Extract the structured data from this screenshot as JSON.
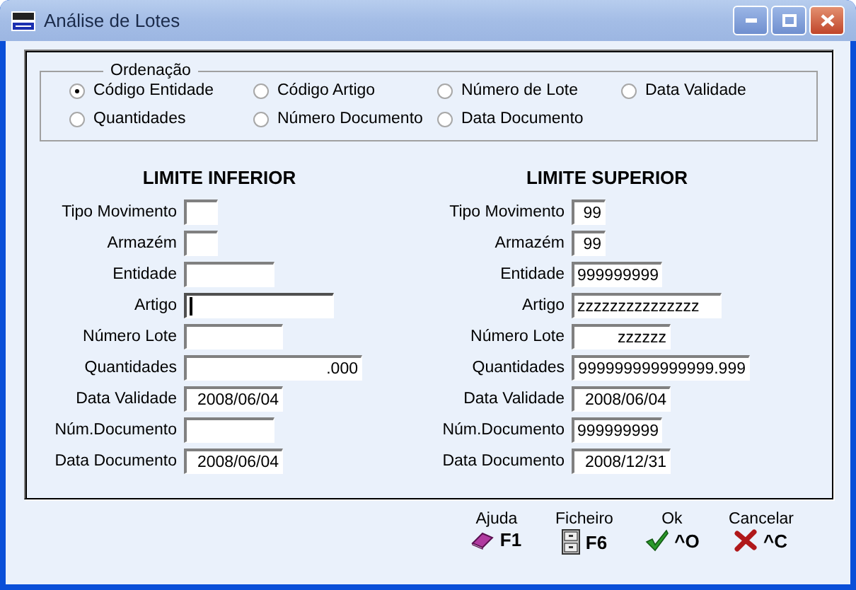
{
  "window": {
    "title": "Análise de Lotes"
  },
  "ordering": {
    "title": "Ordenação",
    "options": [
      {
        "label": "Código Entidade",
        "selected": true
      },
      {
        "label": "Código Artigo",
        "selected": false
      },
      {
        "label": "Número de Lote",
        "selected": false
      },
      {
        "label": "Data Validade",
        "selected": false
      },
      {
        "label": "Quantidades",
        "selected": false
      },
      {
        "label": "Número Documento",
        "selected": false
      },
      {
        "label": "Data Documento",
        "selected": false
      }
    ]
  },
  "limits": [
    {
      "title": "LIMITE INFERIOR",
      "fields": [
        {
          "label": "Tipo Movimento",
          "focused": false
        },
        {
          "label": "Armazém",
          "focused": false
        },
        {
          "label": "Entidade",
          "focused": false
        },
        {
          "label": "Artigo",
          "focused": true
        },
        {
          "label": "Número Lote",
          "focused": false
        },
        {
          "label": "Quantidades",
          "value": ".000",
          "focused": false
        },
        {
          "label": "Data Validade",
          "value": "2008/06/04",
          "focused": false
        },
        {
          "label": "Núm.Documento",
          "focused": false
        },
        {
          "label": "Data Documento",
          "value": "2008/06/04",
          "focused": false
        }
      ]
    },
    {
      "title": "LIMITE SUPERIOR",
      "fields": [
        {
          "label": "Tipo Movimento",
          "value": "99",
          "focused": false
        },
        {
          "label": "Armazém",
          "value": "99",
          "focused": false
        },
        {
          "label": "Entidade",
          "value": "999999999",
          "focused": false
        },
        {
          "label": "Artigo",
          "value": "zzzzzzzzzzzzzzz",
          "focused": false
        },
        {
          "label": "Número Lote",
          "value": "zzzzzz",
          "focused": false
        },
        {
          "label": "Quantidades",
          "value": "999999999999999.999",
          "focused": false
        },
        {
          "label": "Data Validade",
          "value": "2008/06/04",
          "focused": false
        },
        {
          "label": "Núm.Documento",
          "value": "999999999",
          "focused": false
        },
        {
          "label": "Data Documento",
          "value": "2008/12/31",
          "focused": false
        }
      ]
    }
  ],
  "buttons": [
    {
      "label": "Ajuda",
      "key": "F1",
      "kind": "help"
    },
    {
      "label": "Ficheiro",
      "key": "F6",
      "kind": "file"
    },
    {
      "label": "Ok",
      "key": "^O",
      "kind": "ok"
    },
    {
      "label": "Cancelar",
      "key": "^C",
      "kind": "cancel"
    }
  ]
}
